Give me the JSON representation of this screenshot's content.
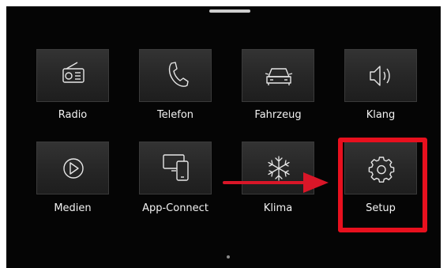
{
  "home_menu": {
    "items": [
      {
        "label": "Radio",
        "icon": "radio-icon"
      },
      {
        "label": "Telefon",
        "icon": "phone-icon"
      },
      {
        "label": "Fahrzeug",
        "icon": "car-icon"
      },
      {
        "label": "Klang",
        "icon": "speaker-icon"
      },
      {
        "label": "Medien",
        "icon": "play-icon"
      },
      {
        "label": "App-Connect",
        "icon": "app-connect-icon"
      },
      {
        "label": "Klima",
        "icon": "snowflake-icon"
      },
      {
        "label": "Setup",
        "icon": "gear-icon"
      }
    ]
  },
  "annotation": {
    "highlight_color": "#e8101e",
    "arrow_color": "#d91628"
  },
  "page_indicator": {
    "current": 1
  }
}
